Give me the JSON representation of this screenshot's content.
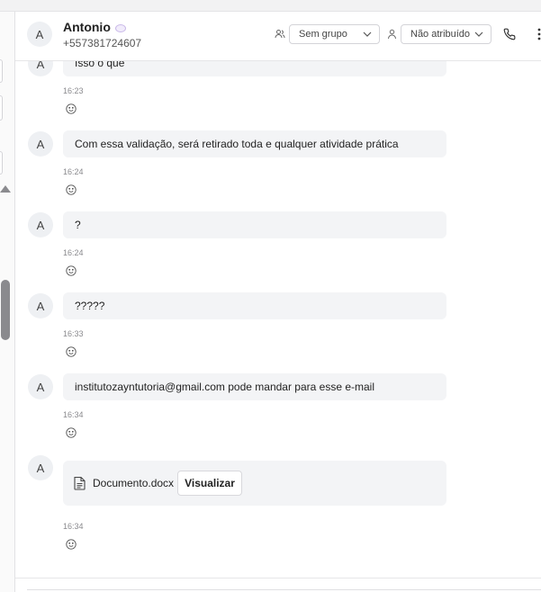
{
  "header": {
    "avatar_initial": "A",
    "contact_name": "Antonio",
    "contact_phone": "+557381724607",
    "group_select": "Sem grupo",
    "assign_select": "Não atribuído"
  },
  "messages": [
    {
      "avatar": "A",
      "text": "Isso o que",
      "time": "16:23"
    },
    {
      "avatar": "A",
      "text": "Com essa validação, será retirado toda e qualquer atividade prática",
      "time": "16:24"
    },
    {
      "avatar": "A",
      "text": "?",
      "time": "16:24"
    },
    {
      "avatar": "A",
      "text": "?????",
      "time": "16:33"
    },
    {
      "avatar": "A",
      "text": "institutozayntutoria@gmail.com pode mandar para esse e-mail",
      "time": "16:34"
    }
  ],
  "attachment": {
    "avatar": "A",
    "file_name": "Documento.docx",
    "view_label": "Visualizar",
    "time": "16:34"
  },
  "icons": {
    "group": "users-icon",
    "user": "user-icon",
    "phone": "phone-icon",
    "more": "more-vertical-icon",
    "document": "document-icon",
    "reaction": "smile-icon"
  },
  "colors": {
    "bubble_bg": "#f3f4f6",
    "avatar_bg": "#eef0f3",
    "border": "#d4d4d8"
  }
}
